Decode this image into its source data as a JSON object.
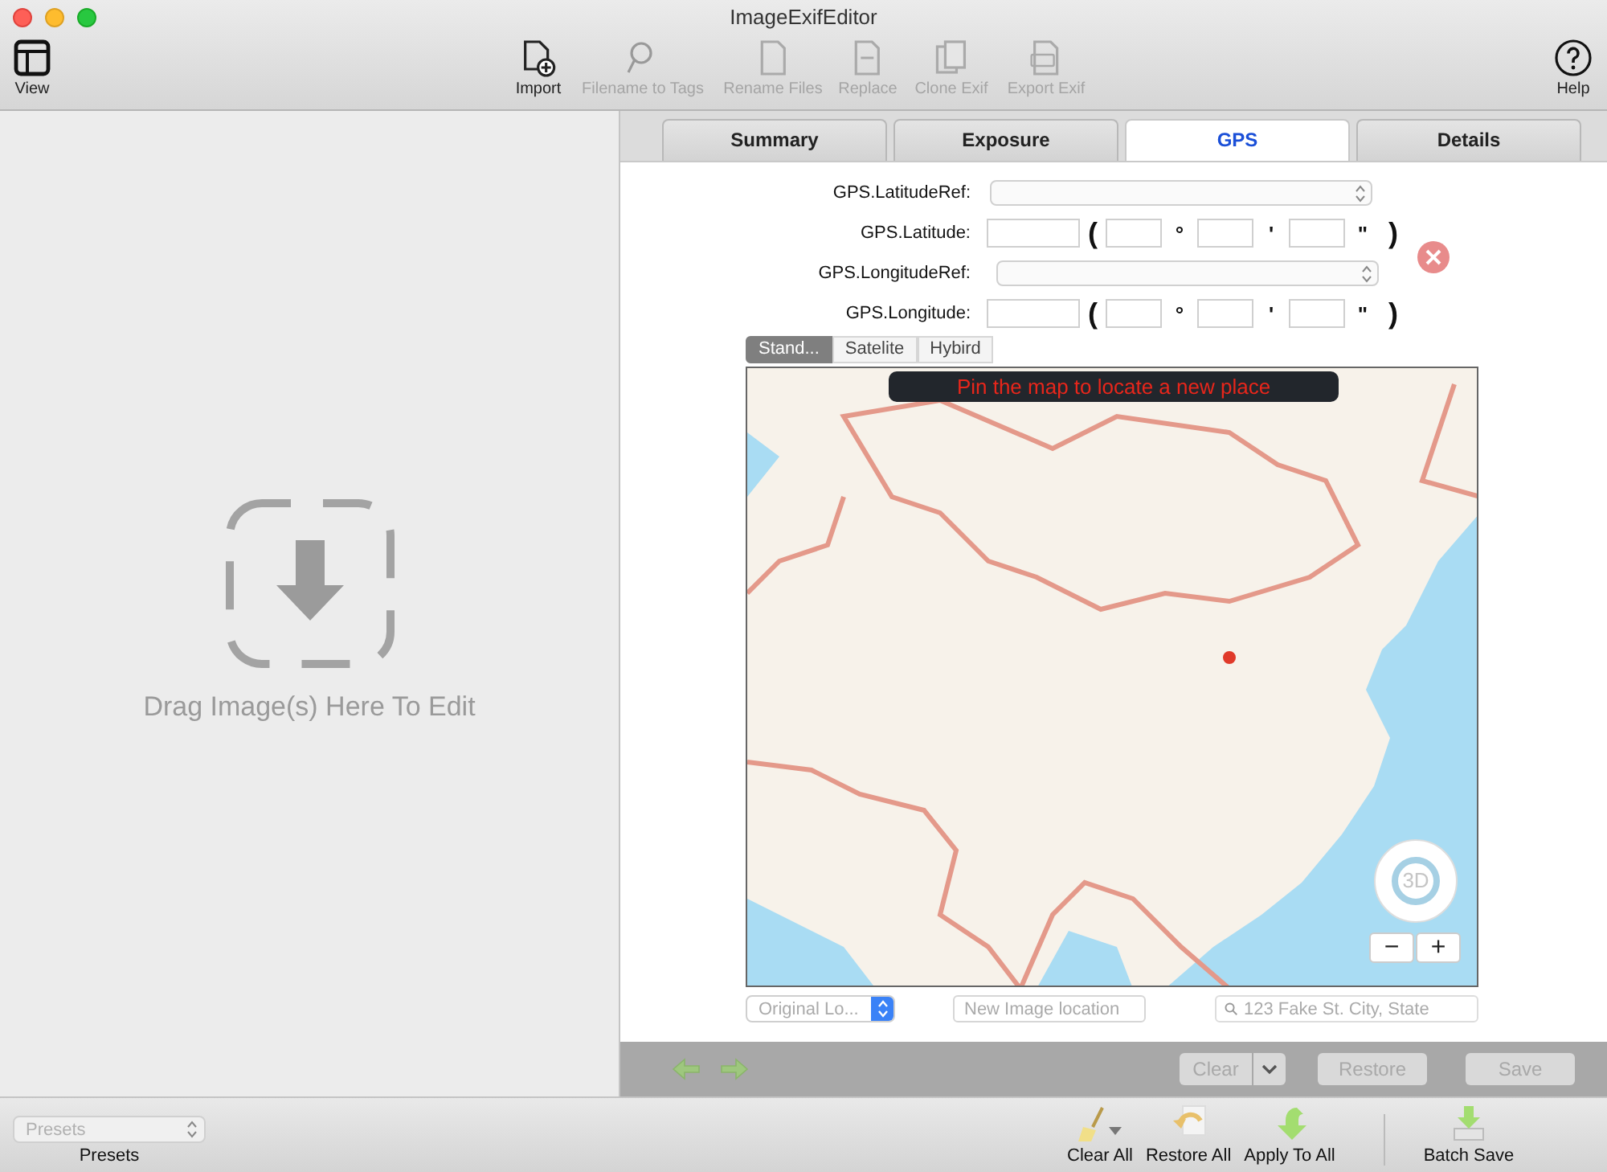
{
  "window": {
    "title": "ImageExifEditor"
  },
  "toolbar": [
    {
      "kind": "view",
      "label": "View",
      "disabled": false
    },
    {
      "kind": "import",
      "label": "Import",
      "disabled": false
    },
    {
      "kind": "tags",
      "label": "Filename to Tags",
      "disabled": true
    },
    {
      "kind": "rename",
      "label": "Rename Files",
      "disabled": true
    },
    {
      "kind": "replace",
      "label": "Replace",
      "disabled": true
    },
    {
      "kind": "clone",
      "label": "Clone Exif",
      "disabled": true
    },
    {
      "kind": "export",
      "label": "Export Exif",
      "disabled": true
    },
    {
      "kind": "help",
      "label": "Help",
      "disabled": false
    }
  ],
  "drop_zone": {
    "text": "Drag Image(s) Here To Edit"
  },
  "tabs": [
    {
      "label": "Summary",
      "selected": false
    },
    {
      "label": "Exposure",
      "selected": false
    },
    {
      "label": "GPS",
      "selected": true
    },
    {
      "label": "Details",
      "selected": false
    }
  ],
  "gps_form": [
    {
      "kind": "select",
      "label": "GPS.LatitudeRef:"
    },
    {
      "kind": "coordinate",
      "label": "GPS.Latitude:",
      "open": "(",
      "units": [
        "°",
        "'",
        "\""
      ],
      "close": ")"
    },
    {
      "kind": "select",
      "label": "GPS.LongitudeRef:"
    },
    {
      "kind": "coordinate",
      "label": "GPS.Longitude:",
      "open": "(",
      "units": [
        "°",
        "'",
        "\""
      ],
      "close": ")"
    }
  ],
  "map_types": [
    {
      "label": "Stand...",
      "selected": true
    },
    {
      "label": "Satelite",
      "selected": false
    },
    {
      "label": "Hybird",
      "selected": false
    }
  ],
  "map": {
    "kind": "picture",
    "banner": "Pin the map to locate a new place",
    "compass": "3D",
    "zoom_out": "−",
    "zoom_in": "+"
  },
  "location_bar": {
    "location_select": "Original Lo...",
    "new_location_placeholder": "New Image location",
    "search_placeholder": "123 Fake St. City, State"
  },
  "action_bar": {
    "buttons": [
      {
        "kind": "split",
        "label": "Clear",
        "disabled": true
      },
      {
        "kind": "plain",
        "label": "Restore",
        "disabled": true
      },
      {
        "kind": "plain",
        "label": "Save",
        "disabled": true
      }
    ]
  },
  "presets": {
    "placeholder": "Presets",
    "label": "Presets"
  },
  "bottom_actions": [
    {
      "kind": "clear",
      "label": "Clear All"
    },
    {
      "kind": "restore",
      "label": "Restore All"
    },
    {
      "kind": "apply",
      "label": "Apply To All"
    },
    {
      "kind": "batch",
      "label": "Batch Save"
    }
  ]
}
